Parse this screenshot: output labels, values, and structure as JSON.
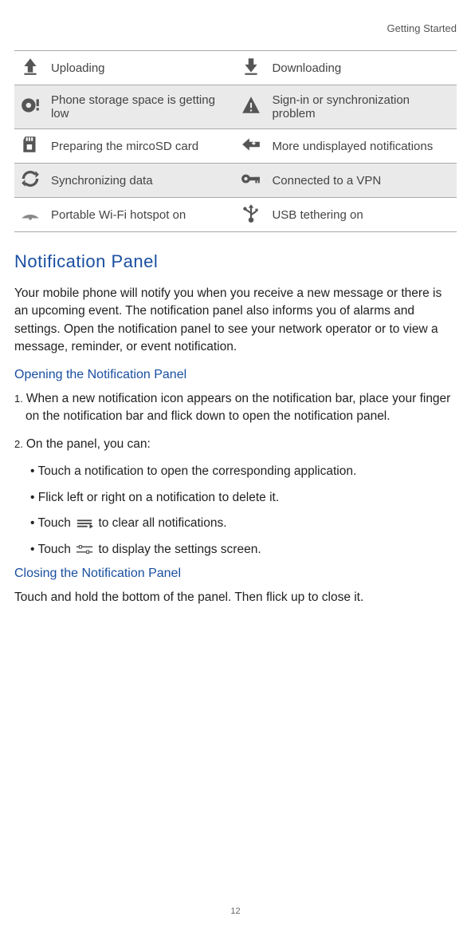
{
  "header": "Getting Started",
  "icons": {
    "row1": {
      "left": "Uploading",
      "right": "Downloading"
    },
    "row2": {
      "left": "Phone storage space is getting low",
      "right": "Sign-in or synchronization problem"
    },
    "row3": {
      "left": "Preparing the mircoSD card",
      "right": "More undisplayed notifications"
    },
    "row4": {
      "left": "Synchronizing data",
      "right": "Connected to a VPN"
    },
    "row5": {
      "left": "Portable Wi-Fi hotspot on",
      "right": "USB tethering on"
    }
  },
  "section_title": "Notification Panel",
  "intro_para": "Your mobile phone will notify you when you receive a new message or there is an upcoming event. The notification panel also informs you of alarms and settings. Open the notification panel to see your network operator or to view a message, reminder, or event notification.",
  "opening_title": "Opening the Notification Panel",
  "step1_num": "1.",
  "step1": "When a new notification icon appears on the notification bar, place your finger on the notification bar and flick down to open the notification panel.",
  "step2_num": "2.",
  "step2": "On the panel, you can:",
  "bullet1": "• Touch a notification to open the corresponding application.",
  "bullet2": "• Flick left or right on a notification to delete it.",
  "bullet3_a": "• Touch ",
  "bullet3_b": " to clear all notifications.",
  "bullet4_a": "• Touch ",
  "bullet4_b": " to display the settings screen.",
  "closing_title": "Closing the Notification Panel",
  "closing_para": "Touch and hold the bottom of the panel. Then flick up to close it.",
  "page_num": "12"
}
